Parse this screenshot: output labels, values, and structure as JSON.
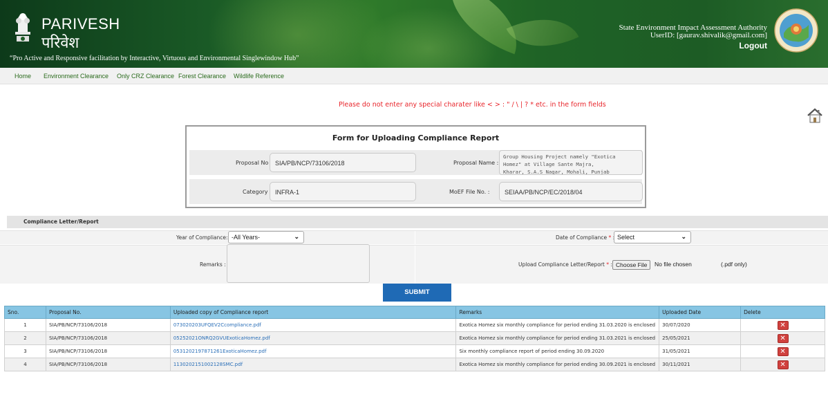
{
  "header": {
    "brand_en": "PARIVESH",
    "brand_hi": "परिवेश",
    "tagline": "“Pro Active and Responsive facilitation by Interactive, Virtuous and Environmental Singlewindow Hub”",
    "authority": "State Environment Impact Assessment Authority",
    "user_id": "UserID: [gaurav.shivalik@gmail.com]",
    "logout": "Logout"
  },
  "nav": {
    "items": [
      "Home",
      "Environment Clearance",
      "Only CRZ Clearance",
      "Forest Clearance",
      "Wildlife Reference"
    ]
  },
  "warning": "Please do not enter any special charater like < > : \" / \\ | ? * etc. in the form fields",
  "form": {
    "title": "Form for Uploading Compliance Report",
    "proposal_no_label": "Proposal No :",
    "proposal_no": "SIA/PB/NCP/73106/2018",
    "proposal_name_label": "Proposal Name :",
    "proposal_name_lines": [
      "Group Housing Project namely \"Exotica",
      "Homez\" at Village Sante Majra,",
      "Kharar, S.A.S Nagar, Mohali, Punjab"
    ],
    "category_label": "Category :",
    "category": "INFRA-1",
    "moef_label": "MoEF File No.  :",
    "moef": "SEIAA/PB/NCP/EC/2018/04"
  },
  "compliance": {
    "section_title": "Compliance Letter/Report",
    "year_label": "Year of Compliance:",
    "year_value": "-All Years-",
    "date_label": "Date of Compliance",
    "date_value": "Select",
    "remarks_label": "Remarks :",
    "upload_label": "Upload Compliance Letter/Report",
    "required_mark": "*",
    "required_colon": " :",
    "choose_file": "Choose File",
    "no_file": "No file chosen",
    "pdf_only": "(.pdf only)",
    "submit": "SUBMIT"
  },
  "table": {
    "headers": [
      "Sno.",
      "Proposal No.",
      "Uploaded copy of Compliance report",
      "Remarks",
      "Uploaded Date",
      "Delete"
    ],
    "rows": [
      {
        "sno": "1",
        "proposal": "SIA/PB/NCP/73106/2018",
        "file": "073020203UFQEV2Ccompliance.pdf",
        "remarks": "Exotica Homez six monthly compliance for period ending 31.03.2020 is enclosed",
        "date": "30/07/2020"
      },
      {
        "sno": "2",
        "proposal": "SIA/PB/NCP/73106/2018",
        "file": "05252021ONRQ2GVUExoticaHomez.pdf",
        "remarks": "Exotica Homez six monthly compliance for period ending 31.03.2021 is enclosed",
        "date": "25/05/2021"
      },
      {
        "sno": "3",
        "proposal": "SIA/PB/NCP/73106/2018",
        "file": "0531202197871261ExoticaHomez.pdf",
        "remarks": "Six monthly compliance report of period ending 30.09.2020",
        "date": "31/05/2021"
      },
      {
        "sno": "4",
        "proposal": "SIA/PB/NCP/73106/2018",
        "file": "1130202151002128SMC.pdf",
        "remarks": "Exotica Homez six monthly compliance for period ending 30.09.2021 is enclosed",
        "date": "30/11/2021"
      }
    ]
  },
  "icons": {
    "emblem": "national-emblem-icon",
    "seal": "state-seal-icon",
    "home": "home-icon",
    "delete": "delete-icon",
    "dropdown": "chevron-down-icon"
  },
  "colors": {
    "header_green": "#1d5c25",
    "warning_red": "#e8242a",
    "submit_blue": "#1f6ab5",
    "table_header": "#87c5e3",
    "link_blue": "#2a6fb8"
  }
}
